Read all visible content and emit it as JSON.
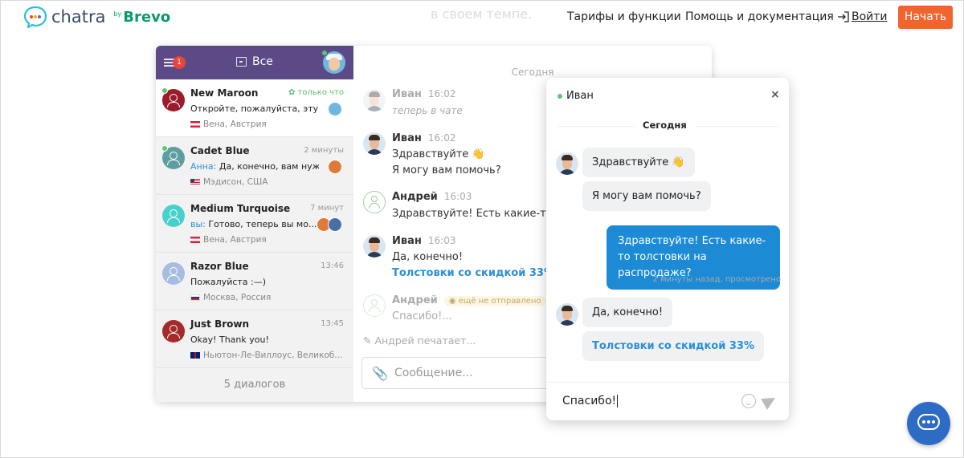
{
  "header": {
    "logo_text": "chatra",
    "logo_by": "by",
    "logo_brevo": "Brevo",
    "faded_heading": "в своем темпе.",
    "nav_tariffs": "Тарифы и функции",
    "nav_help": "Помощь и документация",
    "nav_login": "Войти",
    "start_button": "Начать"
  },
  "sidebar": {
    "badge": "1",
    "filter_label": "Все",
    "conversations": [
      {
        "name": "New Maroon",
        "time": "только что",
        "msg_prefix": "",
        "msg": "Откройте, пожалуйста, эту с...",
        "location": "Вена, Австрия",
        "avatar_color": "#9b1b2a"
      },
      {
        "name": "Cadet Blue",
        "time": "2 минуты",
        "msg_prefix": "Анна:",
        "msg": " Да, конечно, вам нуж...",
        "location": "Мэдисон, США",
        "avatar_color": "#5f9ea0"
      },
      {
        "name": "Medium Turquoise",
        "time": "7 минут",
        "msg_prefix": "вы:",
        "msg": " Готово, теперь вы мо...",
        "location": "Вена, Австрия",
        "avatar_color": "#48d1cc"
      },
      {
        "name": "Razor Blue",
        "time": "13:46",
        "msg_prefix": "",
        "msg": "Пожалуйста :—)",
        "location": "Москва, Россия",
        "avatar_color": "#a7bde0"
      },
      {
        "name": "Just Brown",
        "time": "13:45",
        "msg_prefix": "",
        "msg": "Okay! Thank you!",
        "location": "Ньютон-Ле-Виллоус, Великоб...",
        "avatar_color": "#a52a2a"
      }
    ],
    "footer": "5 диалогов"
  },
  "chat": {
    "today": "Сегодня",
    "messages": [
      {
        "name": "Иван",
        "time": "16:02",
        "lines": [
          "теперь в чате"
        ]
      },
      {
        "name": "Иван",
        "time": "16:02",
        "lines": [
          "Здравствуйте 👋",
          "Я могу вам помочь?"
        ]
      },
      {
        "name": "Андрей",
        "time": "16:03",
        "lines": [
          "Здравствуйте! Есть какие-то то"
        ]
      },
      {
        "name": "Иван",
        "time": "16:03",
        "lines": [
          "Да, конечно!",
          "Толстовки со скидкой 33%"
        ]
      },
      {
        "name": "Андрей",
        "status": "ещё не отправлено",
        "lines": [
          "Спасибо!..."
        ]
      }
    ],
    "typing": "Андрей печатает...",
    "compose_placeholder": "Сообщение..."
  },
  "widget": {
    "agent_name": "Иван",
    "close": "×",
    "today": "Сегодня",
    "bubble_1": "Здравствуйте 👋",
    "bubble_2": "Я могу вам помочь?",
    "bubble_out": "Здравствуйте! Есть какие-то толстовки на распродаже?",
    "status": "2 минуты назад, просмотрено",
    "bubble_3": "Да, конечно!",
    "bubble_4": "Толстовки со скидкой 33%",
    "input_value": "Спасибо!"
  },
  "colors": {
    "brand_orange": "#f0642d",
    "sidebar_purple": "#5b4a86",
    "accent_blue": "#1c8ad4",
    "online_green": "#5bc86b"
  }
}
